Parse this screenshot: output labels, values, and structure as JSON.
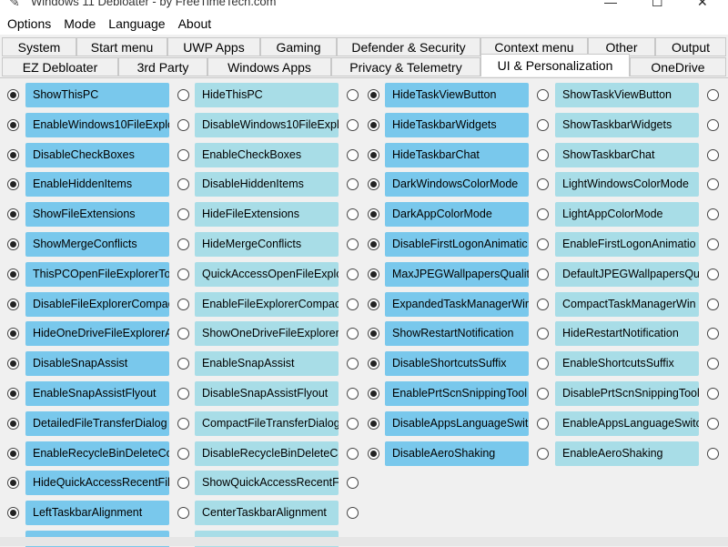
{
  "window": {
    "title": "Windows 11 Debloater - by FreeTimeTech.com",
    "app_icon": "app-icon",
    "minimize_glyph": "—",
    "maximize_glyph": "☐",
    "close_glyph": "✕"
  },
  "menu": [
    "Options",
    "Mode",
    "Language",
    "About"
  ],
  "tabs_row1": [
    "System",
    "Start menu",
    "UWP Apps",
    "Gaming",
    "Defender & Security",
    "Context menu",
    "Other",
    "Output"
  ],
  "tabs_row2": [
    "EZ Debloater",
    "3rd Party",
    "Windows Apps",
    "Privacy & Telemetry",
    "UI & Personalization",
    "OneDrive"
  ],
  "active_tab": "UI & Personalization",
  "colors": {
    "enable_button": "#79c8ec",
    "disable_button": "#a8dde7",
    "panel": "#f0f0f0"
  },
  "left_rows": [
    {
      "a": "ShowThisPC",
      "b": "HideThisPC"
    },
    {
      "a": "EnableWindows10FileExplo",
      "b": "DisableWindows10FileExpl"
    },
    {
      "a": "DisableCheckBoxes",
      "b": "EnableCheckBoxes"
    },
    {
      "a": "EnableHiddenItems",
      "b": "DisableHiddenItems"
    },
    {
      "a": "ShowFileExtensions",
      "b": "HideFileExtensions"
    },
    {
      "a": "ShowMergeConflicts",
      "b": "HideMergeConflicts"
    },
    {
      "a": "ThisPCOpenFileExplorerTo",
      "b": "QuickAccessOpenFileExplc"
    },
    {
      "a": "DisableFileExplorerCompac",
      "b": "EnableFileExplorerCompac"
    },
    {
      "a": "HideOneDriveFileExplorerA",
      "b": "ShowOneDriveFileExplorer"
    },
    {
      "a": "DisableSnapAssist",
      "b": "EnableSnapAssist"
    },
    {
      "a": "EnableSnapAssistFlyout",
      "b": "DisableSnapAssistFlyout"
    },
    {
      "a": "DetailedFileTransferDialog",
      "b": "CompactFileTransferDialog"
    },
    {
      "a": "EnableRecycleBinDeleteCo",
      "b": "DisableRecycleBinDeleteCc"
    },
    {
      "a": "HideQuickAccessRecentFile",
      "b": "ShowQuickAccessRecentFi"
    },
    {
      "a": "LeftTaskbarAlignment",
      "b": "CenterTaskbarAlignment"
    }
  ],
  "right_rows": [
    {
      "a": "HideTaskViewButton",
      "b": "ShowTaskViewButton"
    },
    {
      "a": "HideTaskbarWidgets",
      "b": "ShowTaskbarWidgets"
    },
    {
      "a": "HideTaskbarChat",
      "b": "ShowTaskbarChat"
    },
    {
      "a": "DarkWindowsColorMode",
      "b": "LightWindowsColorMode"
    },
    {
      "a": "DarkAppColorMode",
      "b": "LightAppColorMode"
    },
    {
      "a": "DisableFirstLogonAnimatic",
      "b": "EnableFirstLogonAnimatio"
    },
    {
      "a": "MaxJPEGWallpapersQuality",
      "b": "DefaultJPEGWallpapersQu"
    },
    {
      "a": "ExpandedTaskManagerWir",
      "b": "CompactTaskManagerWin"
    },
    {
      "a": "ShowRestartNotification",
      "b": "HideRestartNotification"
    },
    {
      "a": "DisableShortcutsSuffix",
      "b": "EnableShortcutsSuffix"
    },
    {
      "a": "EnablePrtScnSnippingTool",
      "b": "DisablePrtScnSnippingTool"
    },
    {
      "a": "DisableAppsLanguageSwit",
      "b": "EnableAppsLanguageSwitc"
    },
    {
      "a": "DisableAeroShaking",
      "b": "EnableAeroShaking"
    }
  ]
}
